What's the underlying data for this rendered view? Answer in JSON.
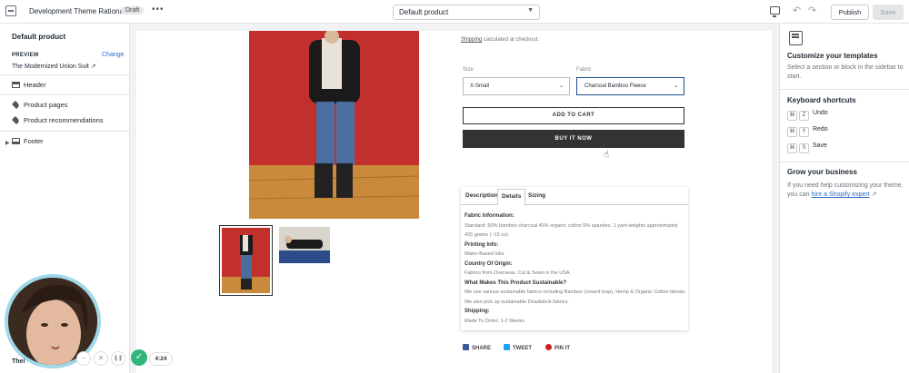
{
  "topbar": {
    "theme_name": "Development Theme Rational",
    "status_badge": "Draft",
    "more": "•••",
    "template_selected": "Default product",
    "publish_label": "Publish",
    "save_label": "Save"
  },
  "sidebar": {
    "title": "Default product",
    "preview_label": "PREVIEW",
    "change_label": "Change",
    "preview_value": "The Modernized Union Suit",
    "items": [
      {
        "label": "Header",
        "icon": "header-icon"
      },
      {
        "label": "Product pages",
        "icon": "tag-icon"
      },
      {
        "label": "Product recommendations",
        "icon": "tag-icon"
      },
      {
        "label": "Footer",
        "icon": "footer-icon"
      }
    ],
    "theme_fragment": "Thei"
  },
  "product": {
    "shipping_link": "Shipping",
    "shipping_text": "calculated at checkout.",
    "size_label": "Size",
    "size_value": "X-Small",
    "fabric_label": "Fabric",
    "fabric_value": "Charcoal Bamboo Fleece",
    "add_to_cart": "ADD TO CART",
    "buy_now": "BUY IT NOW",
    "tabs": [
      "Description",
      "Details",
      "Sizing"
    ],
    "active_tab": "Details",
    "details": [
      {
        "heading": "Fabric Information:",
        "text": "Standard: 50% bamboo charcoal 45% organic cotton 5% spandex. 1 yard weights approximately 425 grams (~15 oz)."
      },
      {
        "heading": "Printing Info:",
        "text": "Water-Based Inks"
      },
      {
        "heading": "Country Of Origin:",
        "text": "Fabrics from Overseas. Cut & Sewn in the USA."
      },
      {
        "heading": "What Makes This Product Sustainable?",
        "text": "We use various sustainable fabrics including Bamboo (closed loop), Hemp & Organic Cotton blends. We also pick up sustainable Deadstock fabrics."
      },
      {
        "heading": "Shipping:",
        "text": "Made To Order: 1-2 Weeks"
      }
    ],
    "share": [
      {
        "label": "SHARE",
        "color": "#3b5998"
      },
      {
        "label": "TWEET",
        "color": "#1da1f2"
      },
      {
        "label": "PIN IT",
        "color": "#cb2027"
      }
    ]
  },
  "right_panel": {
    "customize_title": "Customize your templates",
    "customize_desc": "Select a section or block in the sidebar to start.",
    "shortcuts_title": "Keyboard shortcuts",
    "shortcuts": [
      {
        "mod": "⌘",
        "key": "Z",
        "label": "Undo"
      },
      {
        "mod": "⌘",
        "key": "Y",
        "label": "Redo"
      },
      {
        "mod": "⌘",
        "key": "S",
        "label": "Save"
      }
    ],
    "grow_title": "Grow your business",
    "grow_desc": "If you need help customizing your theme, you can",
    "grow_link": "hire a Shopify expert"
  },
  "recorder": {
    "time": "4:24",
    "minus": "−",
    "close": "✕",
    "pause": "❚❚",
    "check": "✓"
  }
}
